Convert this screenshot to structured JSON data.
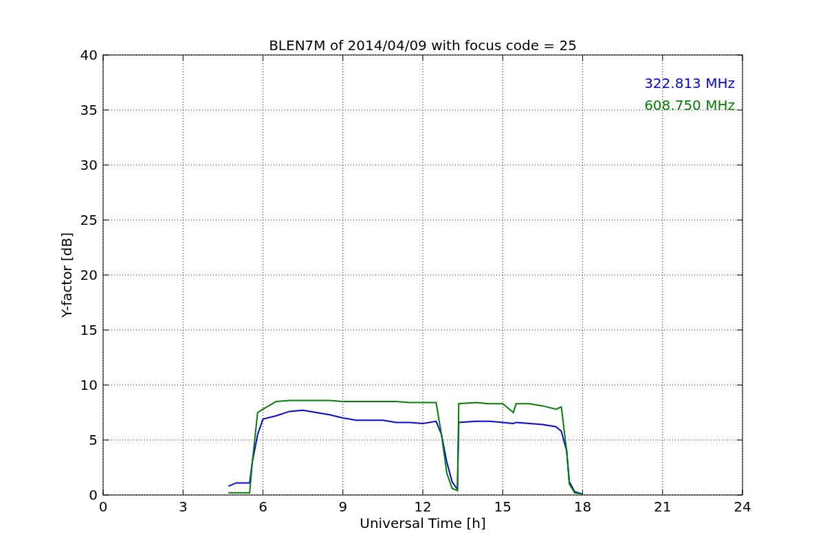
{
  "chart_data": {
    "type": "line",
    "title": "BLEN7M of 2014/04/09 with focus code = 25",
    "xlabel": "Universal Time [h]",
    "ylabel": "Y-factor [dB]",
    "x": [
      4.7,
      5.0,
      5.5,
      5.6,
      5.8,
      6,
      6.5,
      7,
      7.5,
      8,
      8.5,
      9,
      9.5,
      10,
      10.5,
      11,
      11.5,
      12,
      12.5,
      12.7,
      12.9,
      13.1,
      13.3,
      13.35,
      14,
      14.5,
      15,
      15.4,
      15.5,
      16,
      16.5,
      17,
      17.2,
      17.4,
      17.5,
      17.7,
      18
    ],
    "series": [
      {
        "name": "322.813 MHz",
        "color": "#0000ff",
        "values": [
          0.8,
          1.1,
          1.1,
          3,
          5.5,
          6.9,
          7.2,
          7.6,
          7.7,
          7.5,
          7.3,
          7.0,
          6.8,
          6.8,
          6.8,
          6.6,
          6.6,
          6.5,
          6.7,
          5.5,
          3,
          1.2,
          0.5,
          6.6,
          6.7,
          6.7,
          6.6,
          6.5,
          6.6,
          6.5,
          6.4,
          6.2,
          5.8,
          4,
          1.2,
          0.3,
          0.1
        ]
      },
      {
        "name": "608.750 MHz",
        "color": "#008000",
        "values": [
          0.2,
          0.2,
          0.2,
          3,
          7.5,
          7.8,
          8.5,
          8.6,
          8.6,
          8.6,
          8.6,
          8.5,
          8.5,
          8.5,
          8.5,
          8.5,
          8.4,
          8.4,
          8.4,
          5.5,
          2,
          0.6,
          0.4,
          8.3,
          8.4,
          8.3,
          8.3,
          7.5,
          8.3,
          8.3,
          8.1,
          7.8,
          8.0,
          4,
          1.0,
          0.2,
          0.1
        ]
      }
    ],
    "grid": true,
    "xlim": [
      0,
      24
    ],
    "ylim": [
      0,
      40
    ],
    "xticks": [
      0,
      3,
      6,
      9,
      12,
      15,
      18,
      21,
      24
    ],
    "yticks": [
      0,
      5,
      10,
      15,
      20,
      25,
      30,
      35,
      40
    ]
  }
}
